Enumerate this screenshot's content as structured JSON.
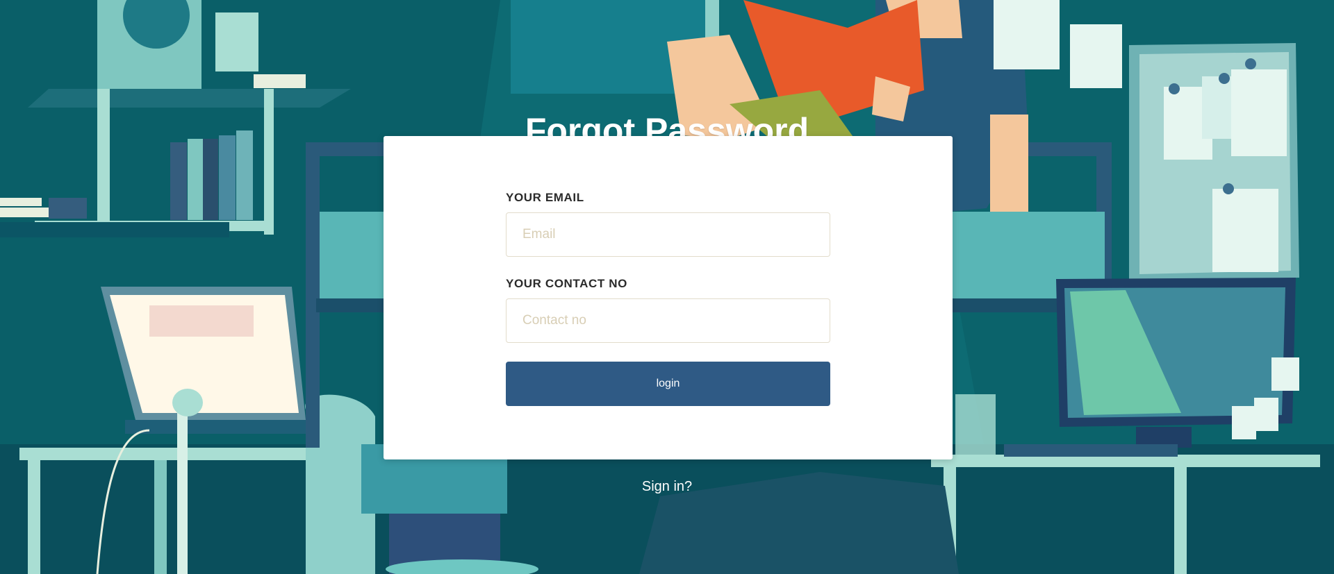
{
  "page": {
    "title": "Forgot Password"
  },
  "form": {
    "email_label": "YOUR EMAIL",
    "email_placeholder": "Email",
    "email_value": "",
    "contact_label": "YOUR CONTACT NO",
    "contact_placeholder": "Contact no",
    "contact_value": "",
    "submit_label": "login"
  },
  "footer": {
    "signin_link": "Sign in?"
  },
  "colors": {
    "background_teal": "#0c6a72",
    "button": "#2f5a85",
    "card": "#ffffff",
    "input_border": "#e2dccb"
  }
}
